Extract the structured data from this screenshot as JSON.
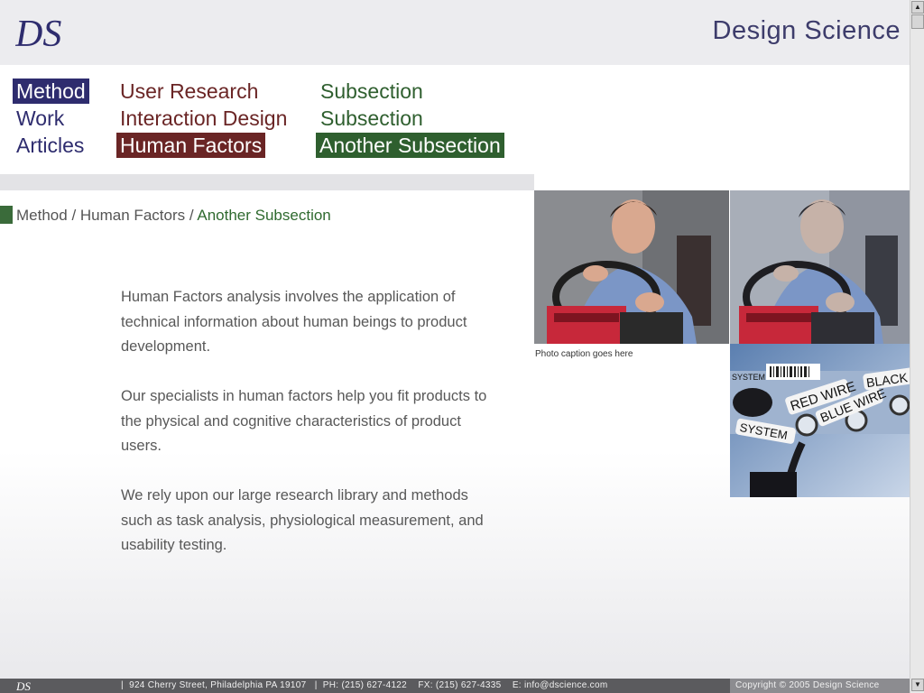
{
  "header": {
    "brand": "Design Science",
    "logo_text": "DS"
  },
  "nav": {
    "col1": [
      {
        "label": "Method",
        "active": true
      },
      {
        "label": "Work",
        "active": false
      },
      {
        "label": "Articles",
        "active": false
      }
    ],
    "col2": [
      {
        "label": "User Research",
        "active": false
      },
      {
        "label": "Interaction Design",
        "active": false
      },
      {
        "label": "Human Factors",
        "active": true
      }
    ],
    "col3": [
      {
        "label": "Subsection",
        "active": false
      },
      {
        "label": "Subsection",
        "active": false
      },
      {
        "label": "Another Subsection",
        "active": true
      }
    ]
  },
  "breadcrumb": {
    "part1": "Method",
    "sep": "/",
    "part2": "Human Factors",
    "current": "Another Subsection"
  },
  "content": {
    "paragraphs": [
      "Human Factors analysis involves the application of technical information about human beings to product development.",
      "Our specialists in human factors help you fit products to the physical and cognitive characteristics of product users.",
      "We rely upon our large research library and methods such as task analysis, physiological measurement, and usability testing."
    ]
  },
  "photos": {
    "caption": "Photo caption goes here",
    "wire_labels": [
      "RED WIRE",
      "BLUE WIRE",
      "BLACK W",
      "SYSTEM",
      "SYSTEM"
    ]
  },
  "footer": {
    "logo_text": "DS",
    "address": "924 Cherry Street, Philadelphia PA 19107",
    "phone": "PH: (215) 627-4122",
    "fax": "FX: (215) 627-4335",
    "email": "E: info@dscience.com",
    "copyright": "Copyright © 2005 Design Science"
  },
  "colors": {
    "primary": "#2e2c6e",
    "secondary": "#6a2525",
    "tertiary": "#2f5f2f"
  }
}
